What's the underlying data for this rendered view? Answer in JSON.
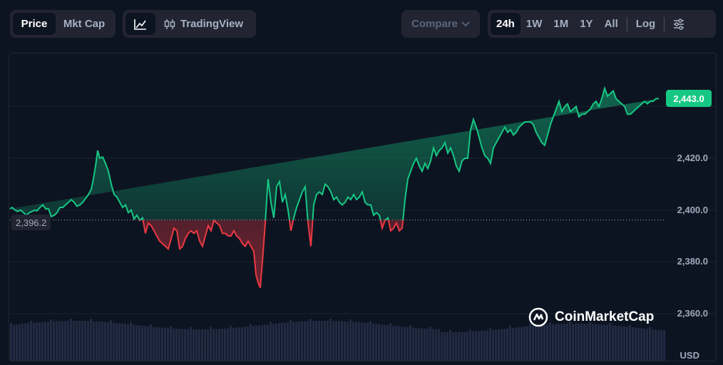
{
  "toolbar": {
    "price_tab": "Price",
    "mktcap_tab": "Mkt Cap",
    "tradingview_label": "TradingView",
    "compare_label": "Compare",
    "ranges": [
      "24h",
      "1W",
      "1M",
      "1Y",
      "All"
    ],
    "log_label": "Log"
  },
  "current_price": "2,443.0",
  "open_price": "2,396.2",
  "currency": "USD",
  "watermark": "CoinMarketCap",
  "colors": {
    "up": "#16c784",
    "down": "#ea3943",
    "background": "#0d1421"
  },
  "chart_data": {
    "type": "area",
    "baseline": 2396.2,
    "ylim": [
      2355,
      2460
    ],
    "yticks": [
      "2,360.0",
      "2,380.0",
      "2,400.0",
      "2,420.0"
    ],
    "yticks_values": [
      2360,
      2380,
      2400,
      2420
    ],
    "x": [
      0,
      3,
      7,
      11,
      15,
      19,
      23,
      27,
      31,
      35,
      38,
      42,
      46,
      50,
      54,
      58,
      62,
      66,
      70,
      74,
      78,
      82,
      86,
      90,
      94,
      98,
      102,
      106,
      110,
      114,
      117,
      120,
      123,
      126,
      130,
      134,
      138,
      142,
      146,
      150,
      154,
      158,
      162,
      166,
      170,
      174,
      178,
      182,
      186,
      190,
      194,
      198,
      202,
      206,
      210,
      214,
      218,
      222,
      226,
      230,
      234,
      238,
      242,
      246,
      250,
      254,
      258,
      262,
      266,
      270,
      274,
      278,
      282,
      286,
      290,
      294,
      298,
      302,
      306,
      310,
      314,
      318,
      322,
      326,
      330,
      334,
      338,
      342,
      345,
      348,
      351,
      354,
      358,
      362,
      366,
      370,
      374,
      378,
      382,
      386,
      390,
      394,
      398,
      402,
      406,
      410,
      414,
      418,
      422,
      426,
      430,
      434,
      438,
      442,
      446,
      450,
      454,
      458,
      462,
      466,
      470,
      474,
      478,
      482,
      486,
      490,
      494,
      498,
      502,
      506,
      510,
      514,
      518,
      522,
      526,
      530,
      534,
      538,
      542,
      546,
      550,
      554,
      558,
      562,
      566,
      570,
      574,
      578,
      582,
      586,
      590,
      594,
      598,
      602,
      606,
      610,
      614,
      618,
      622,
      626,
      630,
      634,
      638,
      642,
      646,
      650,
      654,
      658,
      662,
      666,
      670,
      674,
      678,
      682,
      686,
      690,
      694,
      698,
      702,
      706,
      710,
      714,
      718,
      722,
      726,
      730,
      734,
      738,
      742,
      746,
      750,
      754,
      758,
      762,
      766,
      770,
      774,
      778,
      782,
      786,
      790,
      794,
      798,
      802,
      806,
      810,
      814,
      818,
      822,
      826,
      830,
      834,
      838,
      842,
      846,
      850,
      854,
      858,
      862,
      866,
      870,
      874,
      878,
      882,
      886,
      890,
      894,
      898,
      902,
      906,
      910,
      914,
      918,
      922,
      926,
      930,
      933
    ],
    "values": [
      2400.5,
      2401,
      2400,
      2399.5,
      2400,
      2399,
      2398,
      2399,
      2399.5,
      2400,
      2399.7,
      2401,
      2402,
      2400.5,
      2400.5,
      2397.5,
      2398,
      2399,
      2401,
      2401,
      2402,
      2403,
      2404,
      2403,
      2401.5,
      2402,
      2403,
      2404.5,
      2406,
      2408,
      2412,
      2417,
      2423,
      2420,
      2420.5,
      2418,
      2415,
      2410,
      2406,
      2405,
      2403,
      2401,
      2402,
      2399,
      2400,
      2396.5,
      2398,
      2396,
      2397,
      2391,
      2395,
      2394,
      2392,
      2390,
      2388,
      2387,
      2386,
      2385,
      2389,
      2393,
      2392,
      2385,
      2386,
      2389,
      2391,
      2392,
      2391,
      2392,
      2388,
      2386,
      2390,
      2394,
      2392,
      2396,
      2395,
      2394,
      2391,
      2391,
      2390,
      2390,
      2392,
      2390,
      2389,
      2387,
      2386,
      2388,
      2386,
      2384,
      2375,
      2372,
      2370,
      2380,
      2395,
      2412,
      2403,
      2397,
      2409,
      2411,
      2403,
      2406,
      2400,
      2392,
      2397,
      2401,
      2404,
      2407,
      2409,
      2395,
      2386,
      2402,
      2406,
      2407,
      2406,
      2410,
      2409,
      2407,
      2404,
      2405,
      2403,
      2402,
      2403,
      2405,
      2404,
      2406,
      2404,
      2405,
      2407,
      2403,
      2402,
      2402,
      2398,
      2399,
      2398,
      2393,
      2396,
      2397,
      2392,
      2393,
      2395,
      2392,
      2393,
      2404,
      2412,
      2415,
      2418,
      2420,
      2417,
      2415,
      2418,
      2416,
      2419,
      2424,
      2421,
      2423,
      2424,
      2426,
      2422,
      2424,
      2421,
      2417,
      2415,
      2419,
      2420,
      2420,
      2431,
      2435,
      2432,
      2428,
      2424,
      2421,
      2420,
      2418,
      2424,
      2426,
      2428,
      2430,
      2432,
      2430,
      2431,
      2429,
      2430,
      2432,
      2433,
      2434,
      2434,
      2434,
      2433,
      2430,
      2428,
      2426,
      2425,
      2429,
      2433,
      2436,
      2439,
      2442,
      2438,
      2440,
      2441,
      2438,
      2439,
      2440,
      2436,
      2437,
      2437,
      2438,
      2439,
      2441,
      2442,
      2440,
      2443,
      2447,
      2444,
      2445,
      2446,
      2443,
      2442,
      2441,
      2440,
      2437,
      2437,
      2438,
      2439,
      2440,
      2441,
      2442,
      2441,
      2442,
      2442,
      2443,
      2443
    ],
    "volume_note": "volume bars"
  }
}
